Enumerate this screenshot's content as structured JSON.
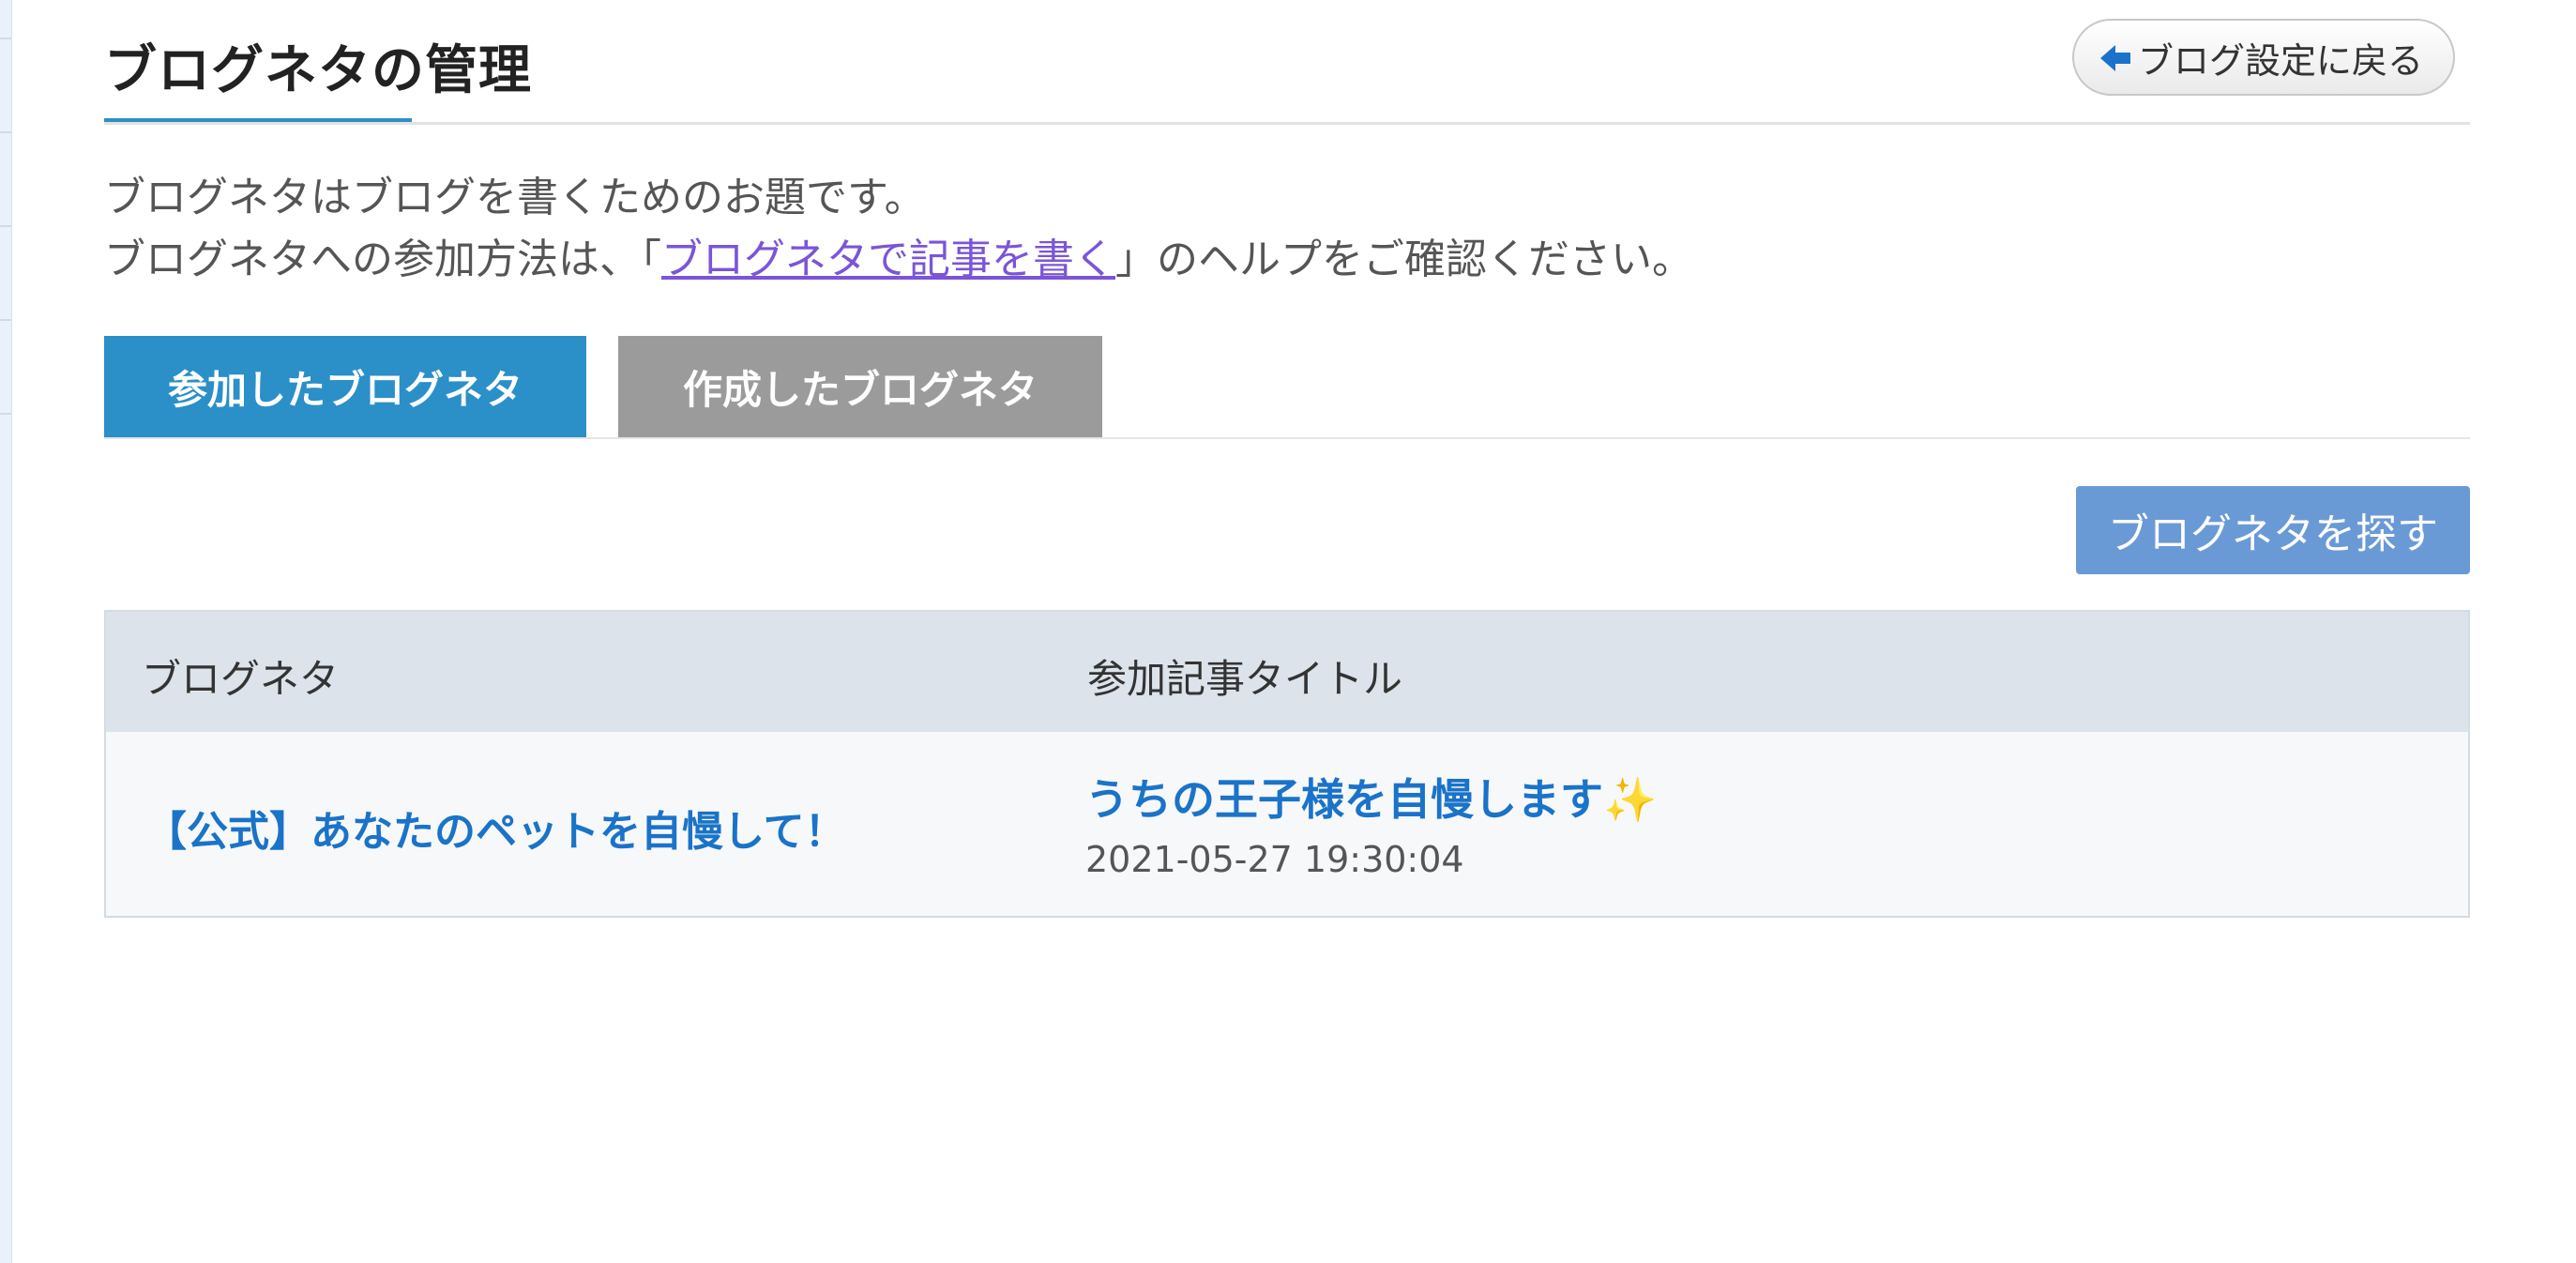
{
  "header": {
    "title": "ブログネタの管理",
    "back_label": "ブログ設定に戻る"
  },
  "description": {
    "line1": "ブログネタはブログを書くためのお題です。",
    "line2_before": "ブログネタへの参加方法は、「",
    "line2_link": "ブログネタで記事を書く",
    "line2_after": "」のヘルプをご確認ください。"
  },
  "tabs": [
    {
      "label": "参加したブログネタ",
      "active": true
    },
    {
      "label": "作成したブログネタ",
      "active": false
    }
  ],
  "find_button_label": "ブログネタを探す",
  "table": {
    "columns": [
      "ブログネタ",
      "参加記事タイトル"
    ],
    "rows": [
      {
        "topic": "【公式】あなたのペットを自慢して！",
        "article_title": "うちの王子様を自慢します",
        "article_emoji": "✨",
        "date": "2021-05-27 19:30:04"
      }
    ]
  },
  "colors": {
    "accent_blue": "#2b8fc8",
    "inactive_tab": "#9b9b9b",
    "find_button": "#6a9ad6",
    "link_blue": "#1a73c9",
    "visited_link": "#7a55d9"
  }
}
